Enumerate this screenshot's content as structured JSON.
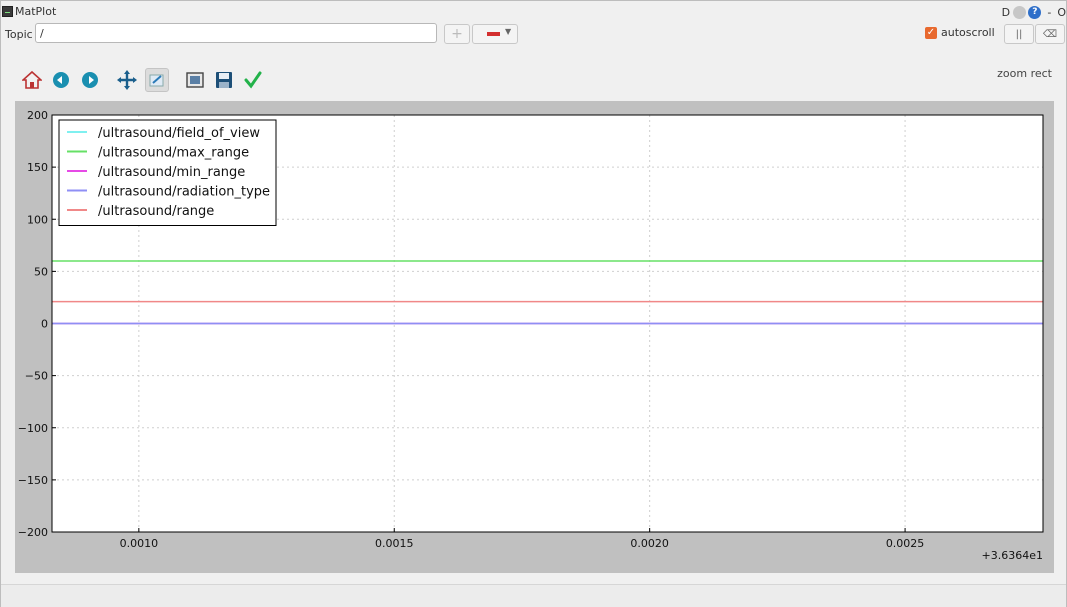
{
  "window": {
    "title": "MatPlot"
  },
  "titlebar": {
    "d_label": "D",
    "help_label": "?",
    "minimize_label": "-",
    "close_label": "O"
  },
  "topic": {
    "label": "Topic",
    "value": "/"
  },
  "controls": {
    "autoscroll_label": "autoscroll",
    "autoscroll_checked": true,
    "add_label": "+",
    "pause_label": "||",
    "clear_label": "⌫"
  },
  "toolbar": {
    "tools": [
      "home-icon",
      "back-icon",
      "forward-icon",
      "pan-icon",
      "zoom-icon",
      "configure-subplots-icon",
      "save-icon",
      "edit-curve-icon"
    ],
    "mode_label": "zoom rect"
  },
  "chart_data": {
    "type": "line",
    "title": "",
    "xlabel": "",
    "ylabel": "",
    "x_offset_label": "+3.6364e1",
    "xlim": [
      0.00083,
      0.00277
    ],
    "ylim": [
      -200,
      200
    ],
    "x_ticks": [
      0.001,
      0.0015,
      0.002,
      0.0025
    ],
    "x_tick_labels": [
      "0.0010",
      "0.0015",
      "0.0020",
      "0.0025"
    ],
    "y_ticks": [
      200,
      150,
      100,
      50,
      0,
      -50,
      -100,
      -150,
      -200
    ],
    "y_tick_labels": [
      "200",
      "150",
      "100",
      "50",
      "0",
      "−50",
      "−100",
      "−150",
      "−200"
    ],
    "grid": true,
    "legend_position": "top-left",
    "series": [
      {
        "name": "/ultrasound/field_of_view",
        "color": "#7ff0f0",
        "x": [
          0.00083,
          0.00277
        ],
        "y": [
          0,
          0
        ]
      },
      {
        "name": "/ultrasound/max_range",
        "color": "#66e066",
        "x": [
          0.00083,
          0.00277
        ],
        "y": [
          60,
          60
        ]
      },
      {
        "name": "/ultrasound/min_range",
        "color": "#e64ae6",
        "x": [
          0.00083,
          0.00277
        ],
        "y": [
          0,
          0
        ]
      },
      {
        "name": "/ultrasound/radiation_type",
        "color": "#8f8ff5",
        "x": [
          0.00083,
          0.00277
        ],
        "y": [
          0,
          0
        ]
      },
      {
        "name": "/ultrasound/range",
        "color": "#f08888",
        "x": [
          0.00083,
          0.00277
        ],
        "y": [
          21,
          21
        ]
      }
    ]
  }
}
